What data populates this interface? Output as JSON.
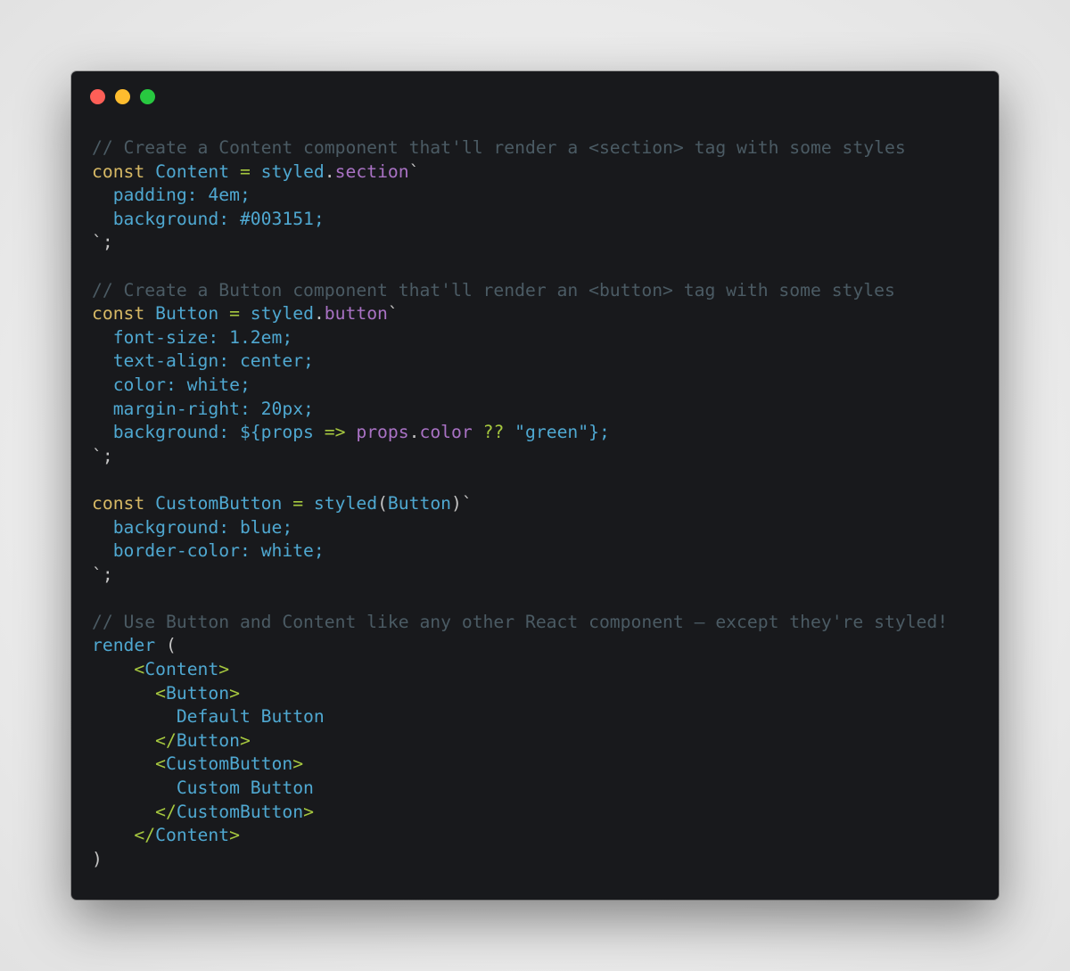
{
  "window": {
    "traffic_lights": [
      {
        "name": "close",
        "color": "#fe5f57"
      },
      {
        "name": "minimize",
        "color": "#febc2e"
      },
      {
        "name": "maximize",
        "color": "#28c840"
      }
    ]
  },
  "theme": {
    "background": "#18191c",
    "comment": "#4b5b64",
    "keyword": "#d7b965",
    "identifier": "#4fa8d1",
    "operator": "#a6c83f",
    "property": "#a972c4",
    "punctuation": "#c4c4c4"
  },
  "code": {
    "language": "jsx",
    "lines": [
      [
        [
          "comment",
          "// Create a Content component that'll render a <section> tag with some styles"
        ]
      ],
      [
        [
          "kw",
          "const"
        ],
        [
          "id",
          " Content "
        ],
        [
          "op",
          "="
        ],
        [
          "id",
          " styled"
        ],
        [
          "punc",
          "."
        ],
        [
          "prop",
          "section"
        ],
        [
          "punc",
          "`"
        ]
      ],
      [
        [
          "id",
          "  padding: 4em;"
        ]
      ],
      [
        [
          "id",
          "  background: #003151;"
        ]
      ],
      [
        [
          "punc",
          "`;"
        ]
      ],
      [],
      [
        [
          "comment",
          "// Create a Button component that'll render an <button> tag with some styles"
        ]
      ],
      [
        [
          "kw",
          "const"
        ],
        [
          "id",
          " Button "
        ],
        [
          "op",
          "="
        ],
        [
          "id",
          " styled"
        ],
        [
          "punc",
          "."
        ],
        [
          "prop",
          "button"
        ],
        [
          "punc",
          "`"
        ]
      ],
      [
        [
          "id",
          "  font-size: 1.2em;"
        ]
      ],
      [
        [
          "id",
          "  text-align: center;"
        ]
      ],
      [
        [
          "id",
          "  color: white;"
        ]
      ],
      [
        [
          "id",
          "  margin-right: 20px;"
        ]
      ],
      [
        [
          "id",
          "  background: ${props "
        ],
        [
          "op",
          "=>"
        ],
        [
          "id",
          " "
        ],
        [
          "prop",
          "props"
        ],
        [
          "punc",
          "."
        ],
        [
          "prop",
          "color"
        ],
        [
          "id",
          " "
        ],
        [
          "op",
          "??"
        ],
        [
          "id",
          " \"green\"};"
        ]
      ],
      [
        [
          "punc",
          "`;"
        ]
      ],
      [],
      [
        [
          "kw",
          "const"
        ],
        [
          "id",
          " CustomButton "
        ],
        [
          "op",
          "="
        ],
        [
          "id",
          " styled"
        ],
        [
          "punc",
          "("
        ],
        [
          "id",
          "Button"
        ],
        [
          "punc",
          ")`"
        ]
      ],
      [
        [
          "id",
          "  background: blue;"
        ]
      ],
      [
        [
          "id",
          "  border-color: white;"
        ]
      ],
      [
        [
          "punc",
          "`;"
        ]
      ],
      [],
      [
        [
          "comment",
          "// Use Button and Content like any other React component — except they're styled!"
        ]
      ],
      [
        [
          "id",
          "render "
        ],
        [
          "punc",
          "("
        ]
      ],
      [
        [
          "id",
          "    "
        ],
        [
          "op",
          "<"
        ],
        [
          "id",
          "Content"
        ],
        [
          "op",
          ">"
        ]
      ],
      [
        [
          "id",
          "      "
        ],
        [
          "op",
          "<"
        ],
        [
          "id",
          "Button"
        ],
        [
          "op",
          ">"
        ]
      ],
      [
        [
          "id",
          "        Default Button"
        ]
      ],
      [
        [
          "id",
          "      "
        ],
        [
          "op",
          "</"
        ],
        [
          "id",
          "Button"
        ],
        [
          "op",
          ">"
        ]
      ],
      [
        [
          "id",
          "      "
        ],
        [
          "op",
          "<"
        ],
        [
          "id",
          "CustomButton"
        ],
        [
          "op",
          ">"
        ]
      ],
      [
        [
          "id",
          "        Custom Button"
        ]
      ],
      [
        [
          "id",
          "      "
        ],
        [
          "op",
          "</"
        ],
        [
          "id",
          "CustomButton"
        ],
        [
          "op",
          ">"
        ]
      ],
      [
        [
          "id",
          "    "
        ],
        [
          "op",
          "</"
        ],
        [
          "id",
          "Content"
        ],
        [
          "op",
          ">"
        ]
      ],
      [
        [
          "punc",
          ")"
        ]
      ]
    ]
  }
}
